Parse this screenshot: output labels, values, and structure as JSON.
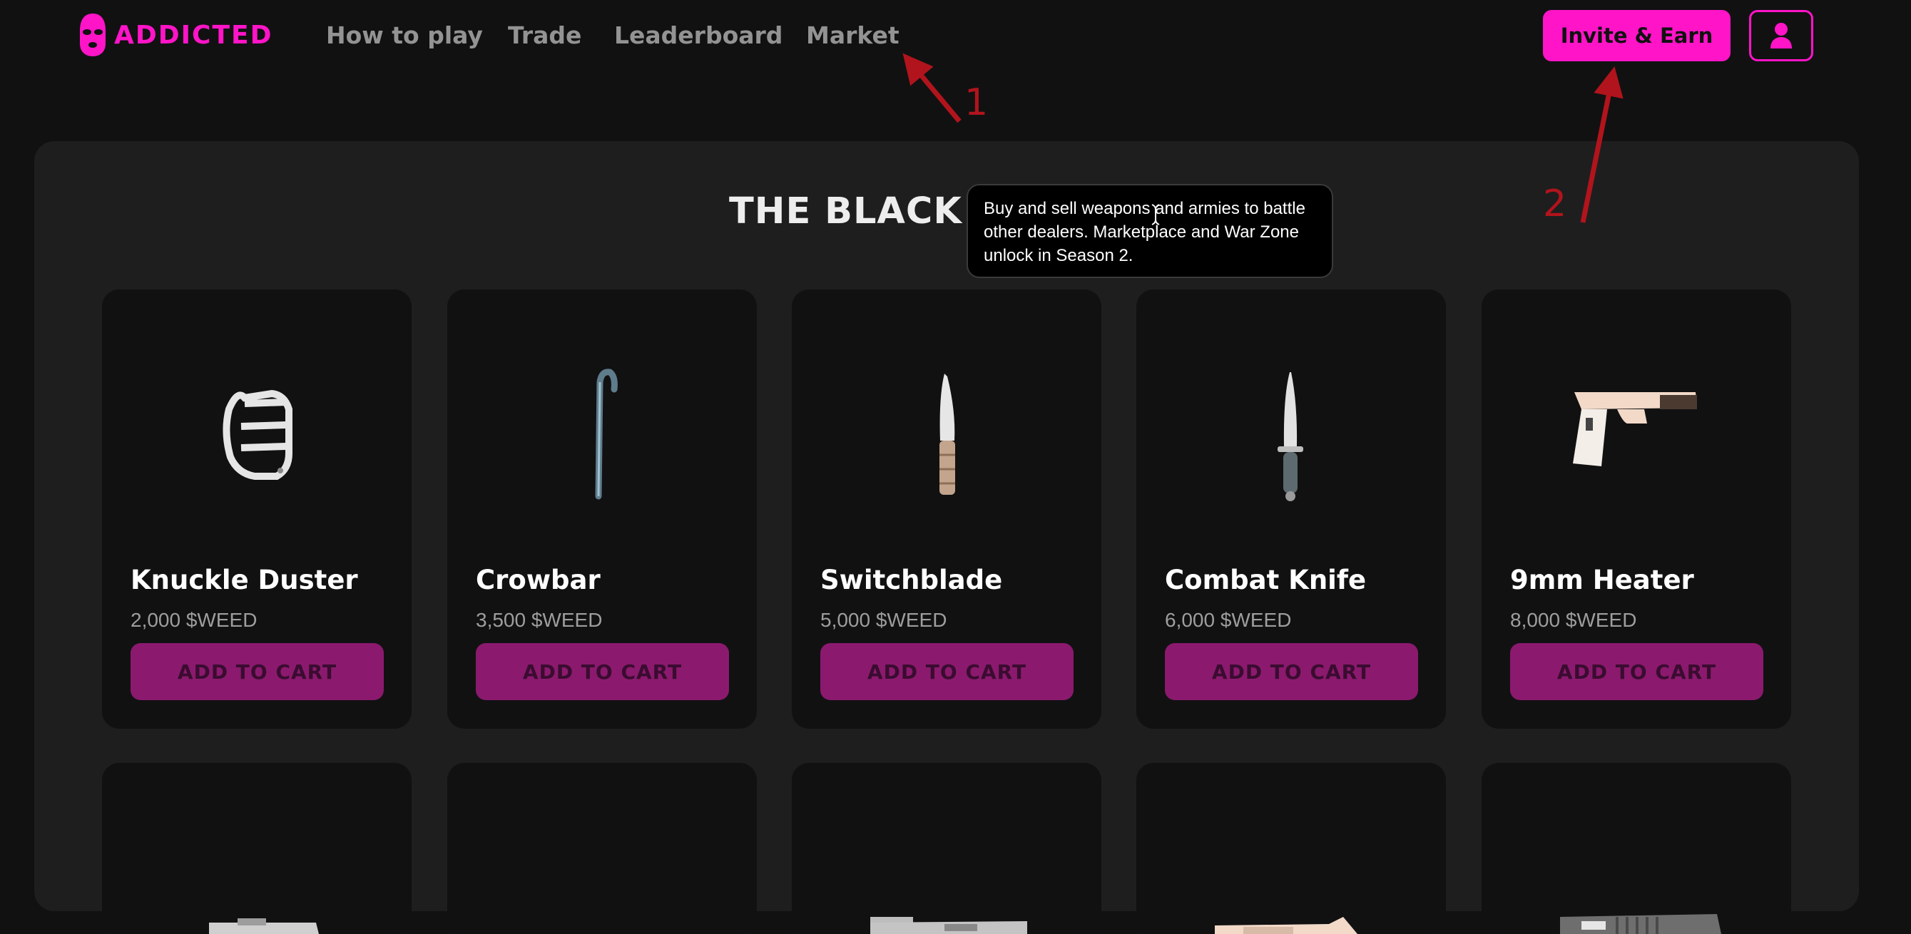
{
  "header": {
    "brand": "ADDICTED",
    "nav": [
      "How to play",
      "Trade",
      "Leaderboard",
      "Market"
    ],
    "invite_label": "Invite & Earn"
  },
  "market": {
    "title": "THE BLACK MARKET",
    "tooltip": "Buy and sell weapons and armies to battle other dealers. Marketplace and War Zone unlock in Season 2.",
    "cart_label": "ADD TO CART",
    "items": [
      {
        "name": "Knuckle Duster",
        "price": "2,000 $WEED",
        "icon": "brass-knuckles-icon"
      },
      {
        "name": "Crowbar",
        "price": "3,500 $WEED",
        "icon": "crowbar-icon"
      },
      {
        "name": "Switchblade",
        "price": "5,000 $WEED",
        "icon": "switchblade-icon"
      },
      {
        "name": "Combat Knife",
        "price": "6,000 $WEED",
        "icon": "combat-knife-icon"
      },
      {
        "name": "9mm Heater",
        "price": "8,000 $WEED",
        "icon": "pistol-icon"
      }
    ],
    "row2_icons": [
      "revolver-icon",
      "shotgun-icon",
      "smg-icon",
      "rifle-icon",
      "assault-rifle-icon"
    ]
  },
  "annotations": [
    "1",
    "2"
  ],
  "colors": {
    "accent": "#ff14c8",
    "cart_button": "#8b1a6e",
    "annotation": "#b1141c",
    "background": "#111112",
    "panel": "#1e1e1f"
  }
}
